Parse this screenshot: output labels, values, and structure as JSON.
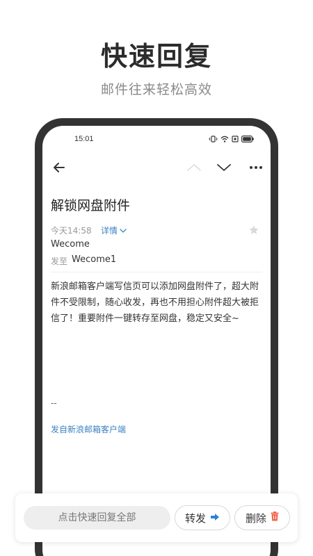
{
  "promo": {
    "title": "快速回复",
    "subtitle": "邮件往来轻松高效"
  },
  "status_bar": {
    "time": "15:01"
  },
  "mail": {
    "subject": "解锁网盘附件",
    "date": "今天14:58",
    "detail_label": "详情",
    "sender": "Wecome",
    "to_label": "发至",
    "recipient": "Wecome1",
    "body": "新浪邮箱客户端写信页可以添加网盘附件了，超大附件不受限制，随心收发，再也不用担心附件超大被拒信了！重要附件一键转存至网盘，稳定又安全~",
    "signature_separator": "--",
    "signature": "发自新浪邮箱客户端"
  },
  "actions": {
    "quick_reply": "点击快速回复全部",
    "forward": "转发",
    "delete": "删除"
  },
  "colors": {
    "accent_blue": "#3b82c4",
    "forward_icon": "#2f7fd6",
    "delete_icon": "#f0674f"
  }
}
